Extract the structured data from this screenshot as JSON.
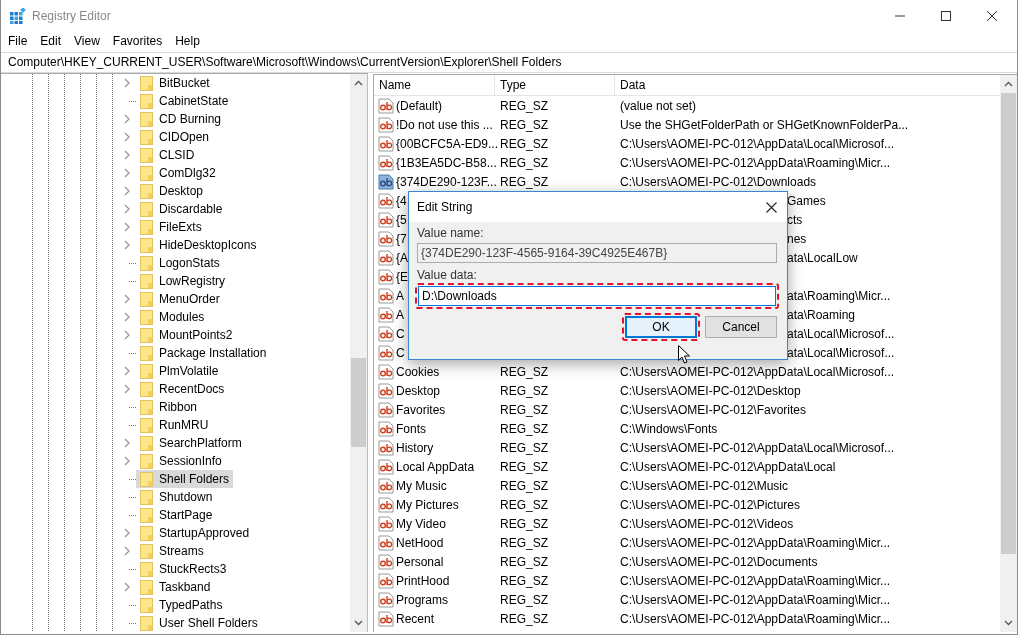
{
  "window": {
    "title": "Registry Editor"
  },
  "menu": [
    "File",
    "Edit",
    "View",
    "Favorites",
    "Help"
  ],
  "address": "Computer\\HKEY_CURRENT_USER\\Software\\Microsoft\\Windows\\CurrentVersion\\Explorer\\Shell Folders",
  "tree": {
    "items": [
      {
        "label": "BitBucket",
        "expandable": true,
        "selected": false
      },
      {
        "label": "CabinetState",
        "expandable": false,
        "selected": false
      },
      {
        "label": "CD Burning",
        "expandable": true,
        "selected": false
      },
      {
        "label": "CIDOpen",
        "expandable": true,
        "selected": false
      },
      {
        "label": "CLSID",
        "expandable": true,
        "selected": false
      },
      {
        "label": "ComDlg32",
        "expandable": true,
        "selected": false
      },
      {
        "label": "Desktop",
        "expandable": true,
        "selected": false
      },
      {
        "label": "Discardable",
        "expandable": true,
        "selected": false
      },
      {
        "label": "FileExts",
        "expandable": true,
        "selected": false
      },
      {
        "label": "HideDesktopIcons",
        "expandable": true,
        "selected": false
      },
      {
        "label": "LogonStats",
        "expandable": false,
        "selected": false
      },
      {
        "label": "LowRegistry",
        "expandable": false,
        "selected": false
      },
      {
        "label": "MenuOrder",
        "expandable": true,
        "selected": false
      },
      {
        "label": "Modules",
        "expandable": true,
        "selected": false
      },
      {
        "label": "MountPoints2",
        "expandable": true,
        "selected": false
      },
      {
        "label": "Package Installation",
        "expandable": false,
        "selected": false
      },
      {
        "label": "PlmVolatile",
        "expandable": true,
        "selected": false
      },
      {
        "label": "RecentDocs",
        "expandable": true,
        "selected": false
      },
      {
        "label": "Ribbon",
        "expandable": false,
        "selected": false
      },
      {
        "label": "RunMRU",
        "expandable": false,
        "selected": false
      },
      {
        "label": "SearchPlatform",
        "expandable": true,
        "selected": false
      },
      {
        "label": "SessionInfo",
        "expandable": true,
        "selected": false
      },
      {
        "label": "Shell Folders",
        "expandable": false,
        "selected": true
      },
      {
        "label": "Shutdown",
        "expandable": false,
        "selected": false
      },
      {
        "label": "StartPage",
        "expandable": false,
        "selected": false
      },
      {
        "label": "StartupApproved",
        "expandable": true,
        "selected": false
      },
      {
        "label": "Streams",
        "expandable": true,
        "selected": false
      },
      {
        "label": "StuckRects3",
        "expandable": false,
        "selected": false
      },
      {
        "label": "Taskband",
        "expandable": true,
        "selected": false
      },
      {
        "label": "TypedPaths",
        "expandable": false,
        "selected": false
      },
      {
        "label": "User Shell Folders",
        "expandable": false,
        "selected": false
      }
    ]
  },
  "values": {
    "columns": [
      "Name",
      "Type",
      "Data"
    ],
    "rows": [
      {
        "kind": "full",
        "name": "(Default)",
        "type": "REG_SZ",
        "data": "(value not set)",
        "selected": false
      },
      {
        "kind": "full",
        "name": "!Do not use this ...",
        "type": "REG_SZ",
        "data": "Use the SHGetFolderPath or SHGetKnownFolderPa...",
        "selected": false
      },
      {
        "kind": "full",
        "name": "{00BCFC5A-ED9...",
        "type": "REG_SZ",
        "data": "C:\\Users\\AOMEI-PC-012\\AppData\\Local\\Microsof...",
        "selected": false
      },
      {
        "kind": "full",
        "name": "{1B3EA5DC-B58...",
        "type": "REG_SZ",
        "data": "C:\\Users\\AOMEI-PC-012\\AppData\\Roaming\\Micr...",
        "selected": false
      },
      {
        "kind": "full",
        "name": "{374DE290-123F...",
        "type": "REG_SZ",
        "data": "C:\\Users\\AOMEI-PC-012\\Downloads",
        "selected": true
      },
      {
        "kind": "covered",
        "name": "{4",
        "data": "Games",
        "selected": false
      },
      {
        "kind": "covered",
        "name": "{5",
        "data": "cts",
        "selected": false
      },
      {
        "kind": "covered",
        "name": "{7",
        "data": "nes",
        "selected": false
      },
      {
        "kind": "covered",
        "name": "{A",
        "data": "ata\\LocalLow",
        "selected": false
      },
      {
        "kind": "covered",
        "name": "{E",
        "selected": false
      },
      {
        "kind": "covered",
        "name": "A",
        "data": "ata\\Roaming\\Micr...",
        "selected": false
      },
      {
        "kind": "covered",
        "name": "A",
        "data": "ata\\Roaming",
        "selected": false
      },
      {
        "kind": "covered",
        "name": "C",
        "data": "ata\\Local\\Microsof...",
        "selected": false
      },
      {
        "kind": "covered",
        "name": "C",
        "data": "ata\\Local\\Microsof...",
        "selected": false
      },
      {
        "kind": "full",
        "name": "Cookies",
        "type": "REG_SZ",
        "data": "C:\\Users\\AOMEI-PC-012\\AppData\\Local\\Microsof...",
        "selected": false
      },
      {
        "kind": "full",
        "name": "Desktop",
        "type": "REG_SZ",
        "data": "C:\\Users\\AOMEI-PC-012\\Desktop",
        "selected": false
      },
      {
        "kind": "full",
        "name": "Favorites",
        "type": "REG_SZ",
        "data": "C:\\Users\\AOMEI-PC-012\\Favorites",
        "selected": false
      },
      {
        "kind": "full",
        "name": "Fonts",
        "type": "REG_SZ",
        "data": "C:\\Windows\\Fonts",
        "selected": false
      },
      {
        "kind": "full",
        "name": "History",
        "type": "REG_SZ",
        "data": "C:\\Users\\AOMEI-PC-012\\AppData\\Local\\Microsof...",
        "selected": false
      },
      {
        "kind": "full",
        "name": "Local AppData",
        "type": "REG_SZ",
        "data": "C:\\Users\\AOMEI-PC-012\\AppData\\Local",
        "selected": false
      },
      {
        "kind": "full",
        "name": "My Music",
        "type": "REG_SZ",
        "data": "C:\\Users\\AOMEI-PC-012\\Music",
        "selected": false
      },
      {
        "kind": "full",
        "name": "My Pictures",
        "type": "REG_SZ",
        "data": "C:\\Users\\AOMEI-PC-012\\Pictures",
        "selected": false
      },
      {
        "kind": "full",
        "name": "My Video",
        "type": "REG_SZ",
        "data": "C:\\Users\\AOMEI-PC-012\\Videos",
        "selected": false
      },
      {
        "kind": "full",
        "name": "NetHood",
        "type": "REG_SZ",
        "data": "C:\\Users\\AOMEI-PC-012\\AppData\\Roaming\\Micr...",
        "selected": false
      },
      {
        "kind": "full",
        "name": "Personal",
        "type": "REG_SZ",
        "data": "C:\\Users\\AOMEI-PC-012\\Documents",
        "selected": false
      },
      {
        "kind": "full",
        "name": "PrintHood",
        "type": "REG_SZ",
        "data": "C:\\Users\\AOMEI-PC-012\\AppData\\Roaming\\Micr...",
        "selected": false
      },
      {
        "kind": "full",
        "name": "Programs",
        "type": "REG_SZ",
        "data": "C:\\Users\\AOMEI-PC-012\\AppData\\Roaming\\Micr...",
        "selected": false
      },
      {
        "kind": "full",
        "name": "Recent",
        "type": "REG_SZ",
        "data": "C:\\Users\\AOMEI-PC-012\\AppData\\Roaming\\Micr...",
        "selected": false
      }
    ]
  },
  "dialog": {
    "title": "Edit String",
    "fields": [
      {
        "label": "Value name:",
        "value": "{374DE290-123F-4565-9164-39C4925E467B}",
        "readonly": true,
        "highlighted": false
      },
      {
        "label": "Value data:",
        "value": "D:\\Downloads",
        "readonly": false,
        "highlighted": true
      }
    ],
    "buttons": [
      {
        "label": "OK",
        "default": true,
        "highlighted": true
      },
      {
        "label": "Cancel",
        "default": false,
        "highlighted": false
      }
    ]
  }
}
